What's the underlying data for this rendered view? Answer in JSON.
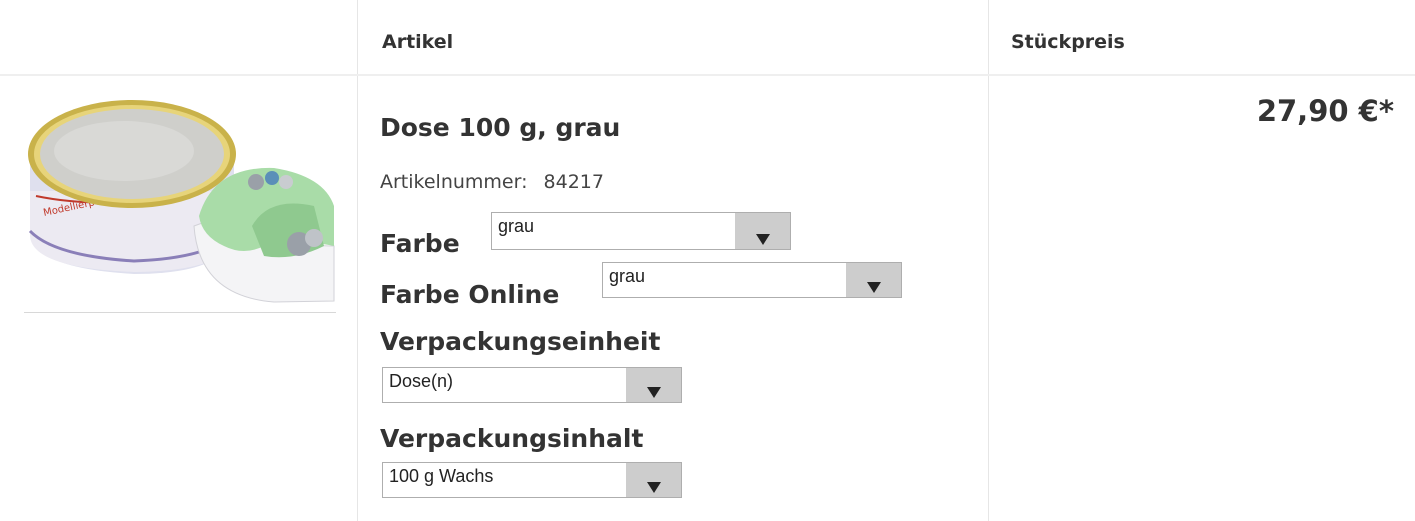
{
  "header": {
    "col_article": "Artikel",
    "col_price": "Stückpreis"
  },
  "product": {
    "image_icon": "wax-tin-product-image",
    "title": "Dose 100 g, grau",
    "article_number_label": "Artikelnummer:",
    "article_number": "84217",
    "price": "27,90 €*",
    "options": {
      "farbe": {
        "label": "Farbe",
        "selected": "grau"
      },
      "farbe_online": {
        "label": "Farbe Online",
        "selected": "grau"
      },
      "verpackungseinheit": {
        "label": "Verpackungseinheit",
        "selected": "Dose(n)"
      },
      "verpackungsinhalt": {
        "label": "Verpackungsinhalt",
        "selected": "100 g Wachs"
      }
    }
  }
}
